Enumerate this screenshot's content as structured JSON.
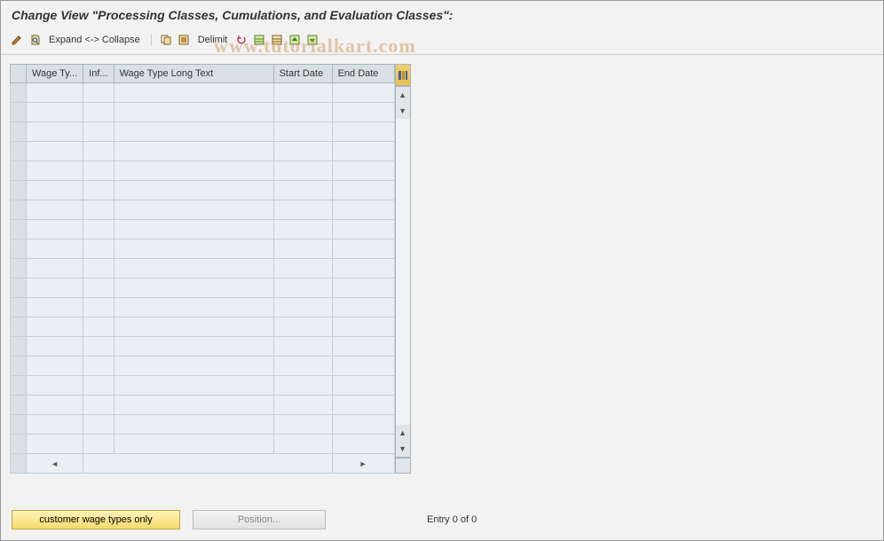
{
  "title": "Change View \"Processing Classes, Cumulations, and Evaluation Classes\":",
  "toolbar": {
    "expand": "Expand <-> Collapse",
    "delimit": "Delimit"
  },
  "columns": {
    "rowsel": "",
    "wagetype": "Wage Ty...",
    "inf": "Inf...",
    "longtext": "Wage Type Long Text",
    "startdate": "Start Date",
    "enddate": "End Date"
  },
  "rows": [
    {
      "wt": "",
      "inf": "",
      "lt": "",
      "sd": "",
      "ed": ""
    },
    {
      "wt": "",
      "inf": "",
      "lt": "",
      "sd": "",
      "ed": ""
    },
    {
      "wt": "",
      "inf": "",
      "lt": "",
      "sd": "",
      "ed": ""
    },
    {
      "wt": "",
      "inf": "",
      "lt": "",
      "sd": "",
      "ed": ""
    },
    {
      "wt": "",
      "inf": "",
      "lt": "",
      "sd": "",
      "ed": ""
    },
    {
      "wt": "",
      "inf": "",
      "lt": "",
      "sd": "",
      "ed": ""
    },
    {
      "wt": "",
      "inf": "",
      "lt": "",
      "sd": "",
      "ed": ""
    },
    {
      "wt": "",
      "inf": "",
      "lt": "",
      "sd": "",
      "ed": ""
    },
    {
      "wt": "",
      "inf": "",
      "lt": "",
      "sd": "",
      "ed": ""
    },
    {
      "wt": "",
      "inf": "",
      "lt": "",
      "sd": "",
      "ed": ""
    },
    {
      "wt": "",
      "inf": "",
      "lt": "",
      "sd": "",
      "ed": ""
    },
    {
      "wt": "",
      "inf": "",
      "lt": "",
      "sd": "",
      "ed": ""
    },
    {
      "wt": "",
      "inf": "",
      "lt": "",
      "sd": "",
      "ed": ""
    },
    {
      "wt": "",
      "inf": "",
      "lt": "",
      "sd": "",
      "ed": ""
    },
    {
      "wt": "",
      "inf": "",
      "lt": "",
      "sd": "",
      "ed": ""
    },
    {
      "wt": "",
      "inf": "",
      "lt": "",
      "sd": "",
      "ed": ""
    },
    {
      "wt": "",
      "inf": "",
      "lt": "",
      "sd": "",
      "ed": ""
    },
    {
      "wt": "",
      "inf": "",
      "lt": "",
      "sd": "",
      "ed": ""
    },
    {
      "wt": "",
      "inf": "",
      "lt": "",
      "sd": "",
      "ed": ""
    }
  ],
  "bottom": {
    "customer": "customer wage types only",
    "position": "Position...",
    "entry": "Entry 0 of 0"
  },
  "watermark": "www.tutorialkart.com"
}
